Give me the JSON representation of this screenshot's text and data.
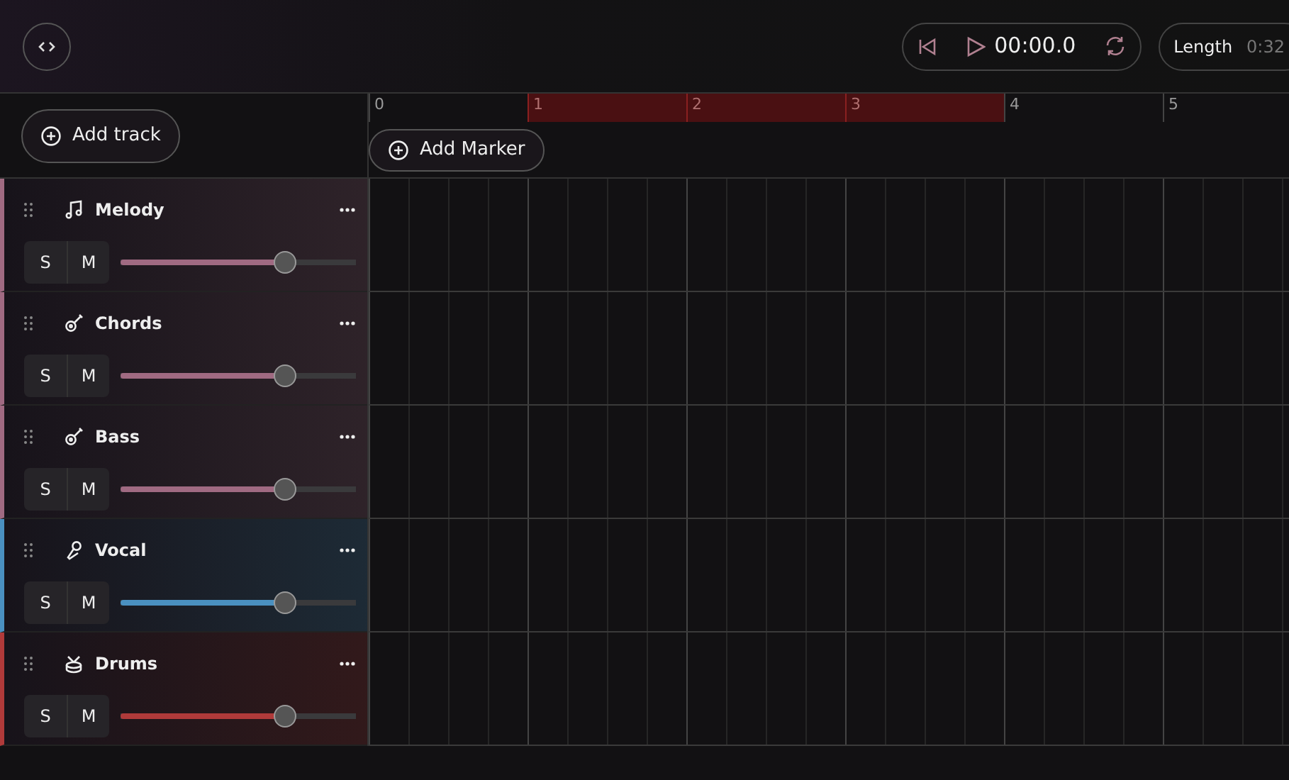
{
  "transport": {
    "time": "00:00.0"
  },
  "length": {
    "label": "Length",
    "value": "0:32"
  },
  "add_track": {
    "label": "Add track"
  },
  "add_marker": {
    "label": "Add Marker"
  },
  "ruler": [
    {
      "label": "0",
      "in_loop": false
    },
    {
      "label": "1",
      "in_loop": true
    },
    {
      "label": "2",
      "in_loop": true
    },
    {
      "label": "3",
      "in_loop": true
    },
    {
      "label": "4",
      "in_loop": false
    },
    {
      "label": "5",
      "in_loop": false
    }
  ],
  "tracks": [
    {
      "name": "Melody",
      "kind": "note",
      "color": "#a06a82",
      "solo_label": "S",
      "mute_label": "M",
      "solo": false,
      "mute": false,
      "level": 0.7
    },
    {
      "name": "Chords",
      "kind": "guitar",
      "color": "#a06a82",
      "solo_label": "S",
      "mute_label": "M",
      "solo": false,
      "mute": false,
      "level": 0.7
    },
    {
      "name": "Bass",
      "kind": "guitar",
      "color": "#a06a82",
      "solo_label": "S",
      "mute_label": "M",
      "solo": false,
      "mute": false,
      "level": 0.7
    },
    {
      "name": "Vocal",
      "kind": "mic",
      "color": "#4a90c0",
      "solo_label": "S",
      "mute_label": "M",
      "solo": false,
      "mute": false,
      "level": 0.7
    },
    {
      "name": "Drums",
      "kind": "drum",
      "color": "#b03a3a",
      "solo_label": "S",
      "mute_label": "M",
      "solo": false,
      "mute": false,
      "level": 0.7
    }
  ]
}
